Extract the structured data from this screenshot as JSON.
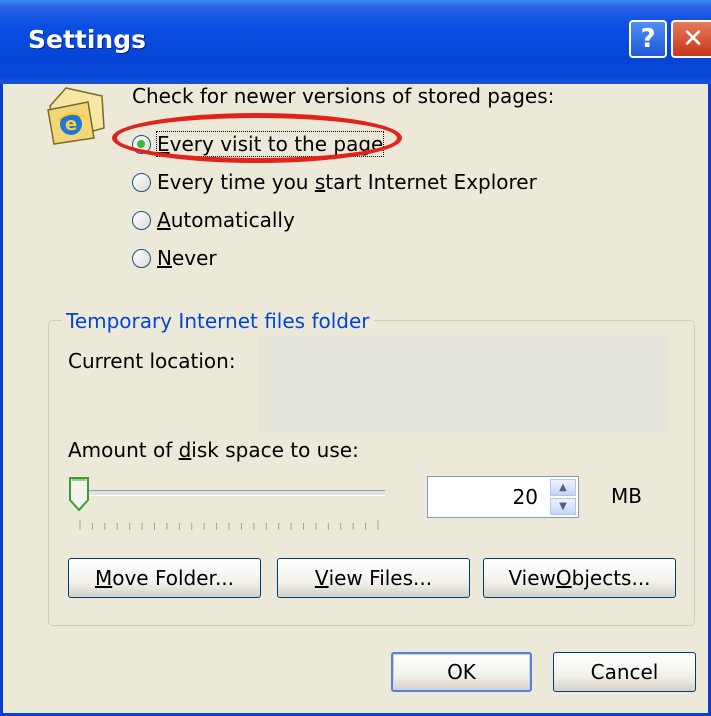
{
  "window": {
    "title": "Settings",
    "help_glyph": "?",
    "close_glyph": "✕"
  },
  "check": {
    "label": "Check for newer versions of stored pages:",
    "options": [
      {
        "pre": "",
        "key": "E",
        "post": "very visit to the page",
        "selected": true
      },
      {
        "pre": "Every time you ",
        "key": "s",
        "post": "tart Internet Explorer",
        "selected": false
      },
      {
        "pre": "",
        "key": "A",
        "post": "utomatically",
        "selected": false
      },
      {
        "pre": "",
        "key": "N",
        "post": "ever",
        "selected": false
      }
    ]
  },
  "temp_folder": {
    "legend": "Temporary Internet files folder",
    "current_location_label": "Current location:",
    "current_location_value": "",
    "disk_space_label_pre": "Amount of ",
    "disk_space_label_key": "d",
    "disk_space_label_post": "isk space to use:",
    "disk_space_value": "20",
    "unit": "MB",
    "slider_level": 0.0,
    "buttons": {
      "move_pre": "",
      "move_key": "M",
      "move_post": "ove Folder...",
      "view_files_pre": "",
      "view_files_key": "V",
      "view_files_post": "iew Files...",
      "view_objects_pre": "View ",
      "view_objects_key": "O",
      "view_objects_post": "bjects..."
    }
  },
  "footer": {
    "ok": "OK",
    "cancel": "Cancel"
  },
  "colors": {
    "titlebar": "#0a4fe3",
    "dialog_bg": "#ece9d8",
    "group_legend": "#0046d5",
    "highlight": "#e2231a",
    "radio_dot": "#3fb33c"
  },
  "icons": [
    "help-icon",
    "close-icon",
    "ie-folder-icon",
    "spin-up-icon",
    "spin-down-icon",
    "slider-thumb-icon"
  ]
}
